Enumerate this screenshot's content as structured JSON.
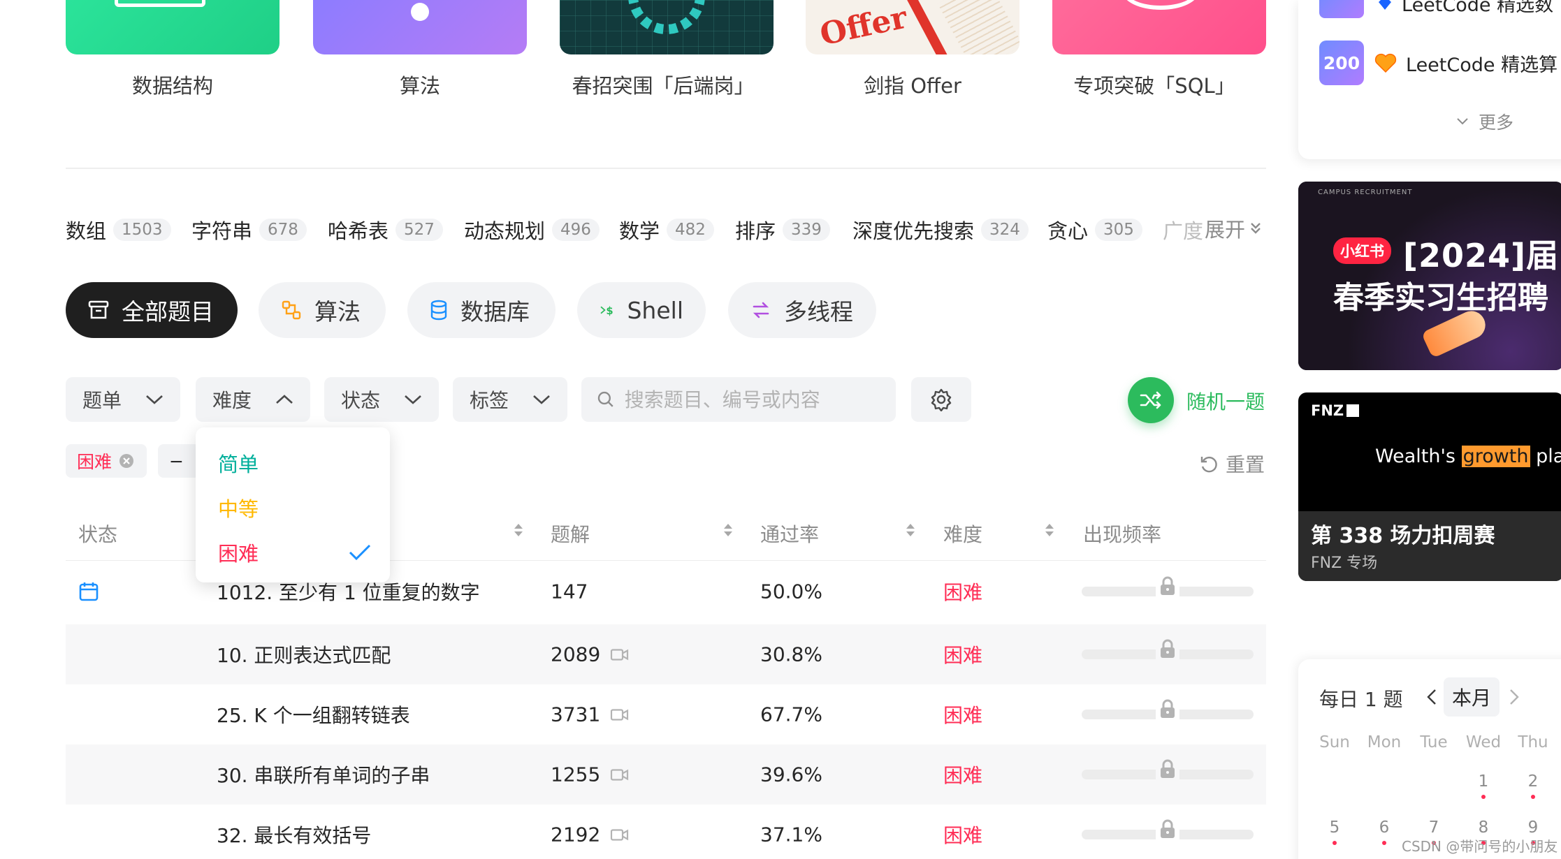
{
  "study_plans": [
    {
      "label": "数据结构",
      "color": "green"
    },
    {
      "label": "算法",
      "color": "purple"
    },
    {
      "label": "春招突围「后端岗」",
      "color": "teal"
    },
    {
      "label": "剑指 Offer",
      "color": "paper"
    },
    {
      "label": "专项突破「SQL」",
      "color": "pink"
    }
  ],
  "offer_card_text": "Offer",
  "tags": [
    {
      "name": "数组",
      "count": "1503"
    },
    {
      "name": "字符串",
      "count": "678"
    },
    {
      "name": "哈希表",
      "count": "527"
    },
    {
      "name": "动态规划",
      "count": "496"
    },
    {
      "name": "数学",
      "count": "482"
    },
    {
      "name": "排序",
      "count": "339"
    },
    {
      "name": "深度优先搜索",
      "count": "324"
    },
    {
      "name": "贪心",
      "count": "305"
    },
    {
      "name": "广度",
      "count": ""
    }
  ],
  "tags_expand_label": "展开",
  "categories": [
    {
      "label": "全部题目",
      "icon": "archive-icon",
      "active": true
    },
    {
      "label": "算法",
      "icon": "algorithm-icon",
      "active": false
    },
    {
      "label": "数据库",
      "icon": "database-icon",
      "active": false
    },
    {
      "label": "Shell",
      "icon": "shell-icon",
      "active": false
    },
    {
      "label": "多线程",
      "icon": "threads-icon",
      "active": false
    }
  ],
  "filters": {
    "list_label": "题单",
    "difficulty_label": "难度",
    "status_label": "状态",
    "tags_label": "标签",
    "search_placeholder": "搜索题目、编号或内容",
    "random_label": "随机一题"
  },
  "active_chips": [
    {
      "label": "困难"
    },
    {
      "label": "−"
    }
  ],
  "reset_label": "重置",
  "difficulty_dropdown": {
    "options": [
      {
        "label": "简单",
        "color": "#00af9b",
        "selected": false
      },
      {
        "label": "中等",
        "color": "#ffb800",
        "selected": false
      },
      {
        "label": "困难",
        "color": "#ff2d55",
        "selected": true
      }
    ]
  },
  "table": {
    "headers": {
      "status": "状态",
      "solutions": "题解",
      "acceptance": "通过率",
      "difficulty": "难度",
      "frequency": "出现频率"
    },
    "rows": [
      {
        "title": "1012. 至少有 1 位重复的数字",
        "solutions": "147",
        "has_video": false,
        "acceptance": "50.0%",
        "difficulty": "困难",
        "daily": true
      },
      {
        "title": "10. 正则表达式匹配",
        "solutions": "2089",
        "has_video": true,
        "acceptance": "30.8%",
        "difficulty": "困难",
        "daily": false
      },
      {
        "title": "25. K 个一组翻转链表",
        "solutions": "3731",
        "has_video": true,
        "acceptance": "67.7%",
        "difficulty": "困难",
        "daily": false
      },
      {
        "title": "30. 串联所有单词的子串",
        "solutions": "1255",
        "has_video": true,
        "acceptance": "39.6%",
        "difficulty": "困难",
        "daily": false
      },
      {
        "title": "32. 最长有效括号",
        "solutions": "2192",
        "has_video": true,
        "acceptance": "37.1%",
        "difficulty": "困难",
        "daily": false
      }
    ]
  },
  "right_panel": {
    "top_item_partial": "LeetCode 精选数",
    "list_item": {
      "badge": "200",
      "label": "LeetCode 精选算",
      "icon": "heart-icon"
    },
    "more_label": "更多"
  },
  "banner1": {
    "brand": "小红书",
    "headline_1": "[2024]届",
    "headline_2": "春季实习生招聘",
    "small_text": "CAMPUS RECRUITMENT"
  },
  "banner2": {
    "logo": "FNZ",
    "tagline_a": "Wealth's",
    "tagline_b": "growth",
    "tagline_c": "platf",
    "title": "第 338 场力扣周赛",
    "subtitle": "FNZ 专场"
  },
  "calendar": {
    "title": "每日 1 题",
    "month_label": "本月",
    "weekdays": [
      "Sun",
      "Mon",
      "Tue",
      "Wed",
      "Thu"
    ],
    "week1": [
      "",
      "",
      "",
      "1",
      "2"
    ],
    "week2": [
      "5",
      "6",
      "7",
      "8",
      "9"
    ]
  },
  "watermark": "CSDN @带问号的小朋友",
  "colors": {
    "accent_green": "#2cbb5d",
    "hard_red": "#ff2d55",
    "medium_yellow": "#ffb800",
    "easy_teal": "#00af9b",
    "check_blue": "#1a90ff"
  }
}
